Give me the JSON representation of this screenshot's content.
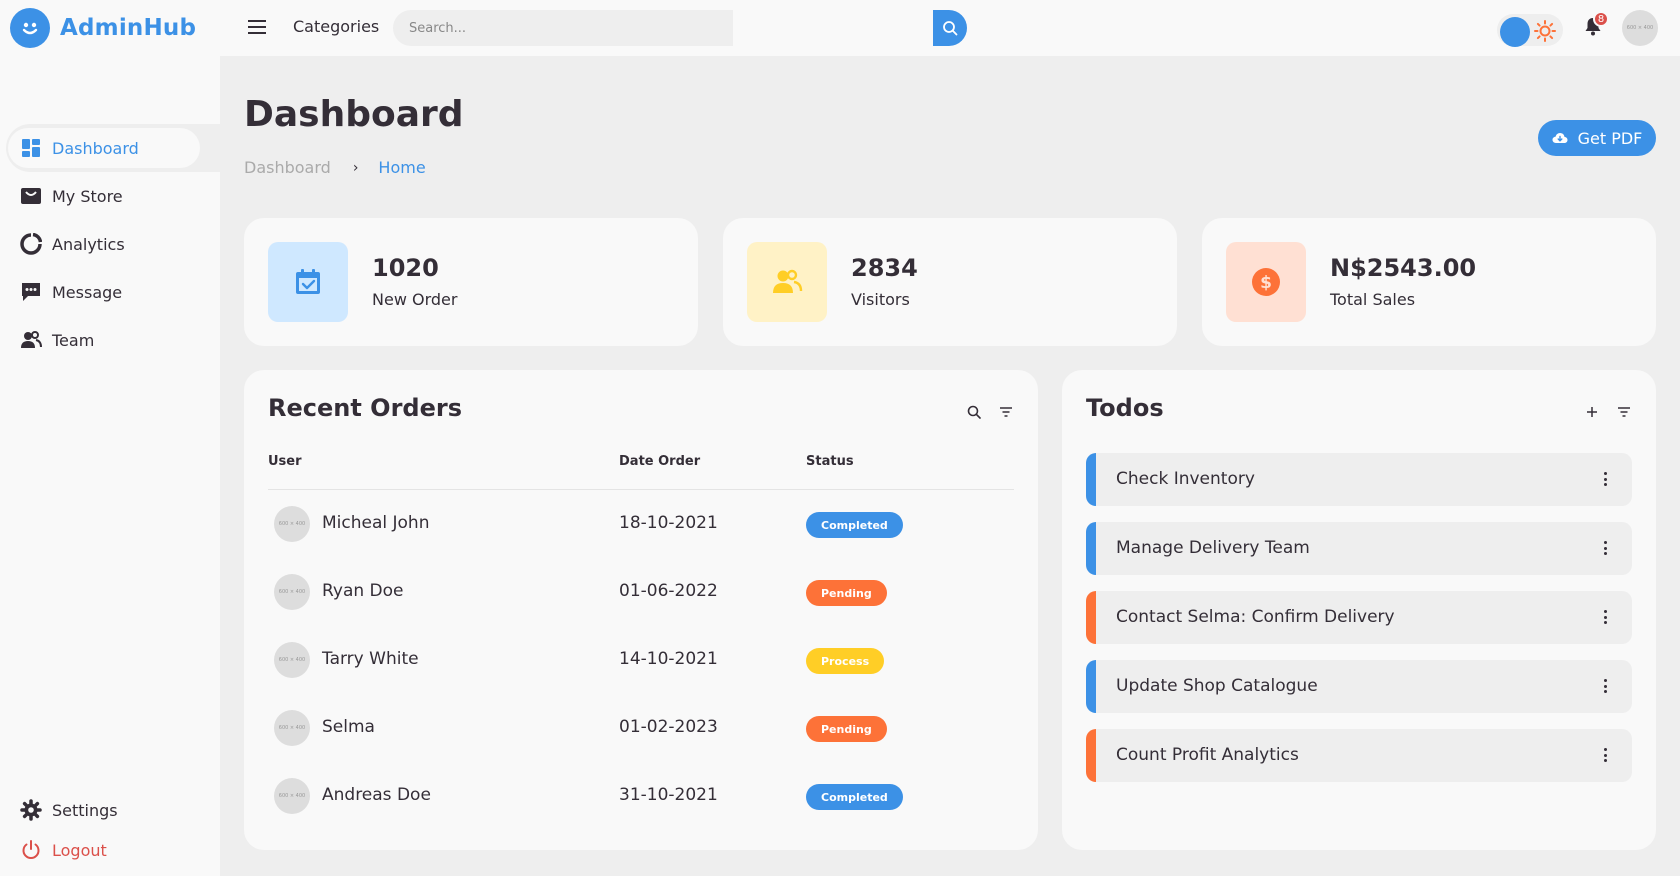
{
  "brand": {
    "name": "AdminHub",
    "icon": "smile-icon"
  },
  "sidebar": {
    "items": [
      {
        "label": "Dashboard",
        "icon": "dashboard-icon",
        "active": true
      },
      {
        "label": "My Store",
        "icon": "store-icon",
        "active": false
      },
      {
        "label": "Analytics",
        "icon": "analytics-icon",
        "active": false
      },
      {
        "label": "Message",
        "icon": "message-icon",
        "active": false
      },
      {
        "label": "Team",
        "icon": "team-icon",
        "active": false
      }
    ],
    "bottom": [
      {
        "label": "Settings",
        "icon": "gear-icon"
      },
      {
        "label": "Logout",
        "icon": "power-icon"
      }
    ]
  },
  "navbar": {
    "link": "Categories",
    "search_placeholder": "Search...",
    "notification_count": "8",
    "avatar_text": "600 × 400"
  },
  "header": {
    "title": "Dashboard",
    "breadcrumb": [
      "Dashboard",
      "Home"
    ],
    "pdf_button": "Get PDF"
  },
  "stats": [
    {
      "value": "1020",
      "label": "New Order",
      "icon": "calendar-check-icon",
      "color": "#3c91e6",
      "bg": "#cfe8ff"
    },
    {
      "value": "2834",
      "label": "Visitors",
      "icon": "users-icon",
      "color": "#ffce26",
      "bg": "#fff2c6"
    },
    {
      "value": "N$2543.00",
      "label": "Total Sales",
      "icon": "dollar-circle-icon",
      "color": "#fd7238",
      "bg": "#ffe0d3"
    }
  ],
  "orders": {
    "title": "Recent Orders",
    "columns": [
      "User",
      "Date Order",
      "Status"
    ],
    "rows": [
      {
        "user": "Micheal John",
        "date": "18-10-2021",
        "status": "Completed",
        "avatar": "600 × 400"
      },
      {
        "user": "Ryan Doe",
        "date": "01-06-2022",
        "status": "Pending",
        "avatar": "600 × 400"
      },
      {
        "user": "Tarry White",
        "date": "14-10-2021",
        "status": "Process",
        "avatar": "600 × 400"
      },
      {
        "user": "Selma",
        "date": "01-02-2023",
        "status": "Pending",
        "avatar": "600 × 400"
      },
      {
        "user": "Andreas Doe",
        "date": "31-10-2021",
        "status": "Completed",
        "avatar": "600 × 400"
      }
    ]
  },
  "todos": {
    "title": "Todos",
    "items": [
      {
        "text": "Check Inventory",
        "state": "completed"
      },
      {
        "text": "Manage Delivery Team",
        "state": "completed"
      },
      {
        "text": "Contact Selma: Confirm Delivery",
        "state": "not-completed"
      },
      {
        "text": "Update Shop Catalogue",
        "state": "completed"
      },
      {
        "text": "Count Profit Analytics",
        "state": "not-completed"
      }
    ]
  },
  "colors": {
    "blue": "#3c91e6",
    "orange": "#fd7238",
    "yellow": "#ffce26",
    "red": "#db504a",
    "dark": "#342e37"
  }
}
